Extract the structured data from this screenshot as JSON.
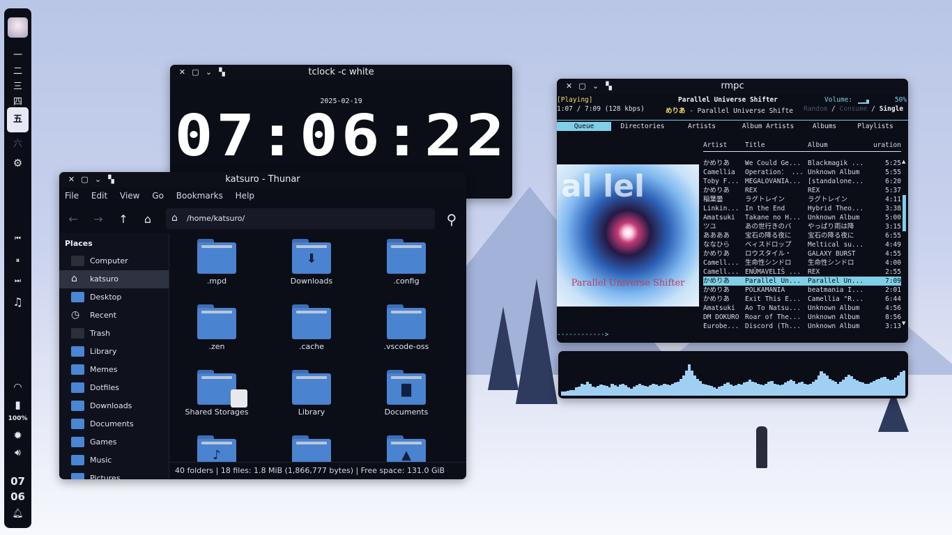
{
  "desktop": {
    "description_colors": {
      "accent": "#7fd0e6",
      "folder": "#4a83cf"
    }
  },
  "bar": {
    "workspaces": [
      "一",
      "二",
      "三",
      "四",
      "五",
      "六"
    ],
    "active_workspace_index": 4,
    "battery_percent": "100%",
    "clock_hour": "07",
    "clock_minute": "06",
    "icons": [
      "settings-icon",
      "previous-icon",
      "pause-icon",
      "next-icon",
      "music-icon",
      "wifi-icon",
      "battery-icon",
      "brightness-icon",
      "volume-icon",
      "bell-icon"
    ]
  },
  "tclock": {
    "window_title": "tclock -c white",
    "date": "2025-02-19",
    "time": "07:06:22"
  },
  "thunar": {
    "window_title": "katsuro - Thunar",
    "menu": [
      "File",
      "Edit",
      "View",
      "Go",
      "Bookmarks",
      "Help"
    ],
    "path": "/home/katsuro/",
    "places_header": "Places",
    "places": [
      {
        "label": "Computer",
        "icon": "computer-icon"
      },
      {
        "label": "katsuro",
        "icon": "home-icon",
        "selected": true
      },
      {
        "label": "Desktop",
        "icon": "folder-icon"
      },
      {
        "label": "Recent",
        "icon": "clock-icon"
      },
      {
        "label": "Trash",
        "icon": "trash-icon"
      },
      {
        "label": "Library",
        "icon": "folder-icon"
      },
      {
        "label": "Memes",
        "icon": "folder-icon"
      },
      {
        "label": "Dotfiles",
        "icon": "folder-icon"
      },
      {
        "label": "Downloads",
        "icon": "folder-icon"
      },
      {
        "label": "Documents",
        "icon": "folder-icon"
      },
      {
        "label": "Games",
        "icon": "folder-icon"
      },
      {
        "label": "Music",
        "icon": "folder-icon"
      },
      {
        "label": "Pictures",
        "icon": "folder-icon"
      }
    ],
    "items": [
      {
        "label": ".mpd",
        "glyph": ""
      },
      {
        "label": "Downloads",
        "glyph": "⬇"
      },
      {
        "label": ".config",
        "glyph": ""
      },
      {
        "label": ".zen",
        "glyph": ""
      },
      {
        "label": ".cache",
        "glyph": ""
      },
      {
        "label": ".vscode-oss",
        "glyph": ""
      },
      {
        "label": "Shared Storages",
        "glyph": ""
      },
      {
        "label": "Library",
        "glyph": ""
      },
      {
        "label": "Documents",
        "glyph": "▇"
      },
      {
        "label": "",
        "glyph": "♪"
      },
      {
        "label": "",
        "glyph": ""
      },
      {
        "label": "",
        "glyph": "▲"
      }
    ],
    "status": "40 folders  |  18 files: 1.8 MiB (1,866,777 bytes)  |  Free space: 131.0 GiB"
  },
  "rmpc": {
    "window_title": "rmpc",
    "state": "[Playing]",
    "song_title": "Parallel Universe Shifter",
    "volume_label": "Volume:",
    "volume_percent": "50%",
    "elapsed": "1:07 / 7:09 (128 kbps)",
    "now_artist": "めりあ",
    "now_line": " - Parallel Universe Shifte",
    "modes": {
      "random": "Random",
      "sep1": " / ",
      "consume": "Consume",
      "sep2": " / ",
      "single": "Single"
    },
    "tabs": [
      "Queue",
      "Directories",
      "Artists",
      "Album Artists",
      "Albums",
      "Playlists"
    ],
    "active_tab": 0,
    "columns": [
      "Artist",
      "Title",
      "Album",
      "uration"
    ],
    "album_art_text": "Parallel Universe Shifter",
    "album_art_big": "al lel",
    "queue": [
      [
        "かめりあ",
        "We Could Ge...",
        "Blackmagik ...",
        "5:25"
      ],
      [
        "Camellia",
        "Operation： ...",
        "Unknown Album",
        "5:55"
      ],
      [
        "Toby F...",
        "MEGALOVANIA...",
        "[standalone...",
        "6:20"
      ],
      [
        "かめりあ",
        "REX",
        "REX",
        "5:37"
      ],
      [
        "稲葉曇",
        "ラグトレイン",
        "ラグトレイン",
        "4:11"
      ],
      [
        "Linkin...",
        "In the End",
        "Hybrid Theo...",
        "3:38"
      ],
      [
        "Amatsuki",
        "Takane no H...",
        "Unknown Album",
        "5:00"
      ],
      [
        "ツユ",
        "あの世行きのバ",
        "やっぱり雨は降",
        "3:15"
      ],
      [
        "ああああ",
        "宝石の降る夜に",
        "宝石の降る夜に",
        "6:55"
      ],
      [
        "ななひら",
        "ベィスドロップ",
        "Meltical su...",
        "4:49"
      ],
      [
        "かめりあ",
        "ロウスタイル・",
        "GALAXY BURST",
        "4:55"
      ],
      [
        "Camell...",
        "生命性シンドロ",
        "生命性シンドロ",
        "4:00"
      ],
      [
        "Camell...",
        "ENŪMAVELIŠ ...",
        "REX",
        "2:55"
      ],
      [
        "かめりあ",
        "Parallel Un...",
        "Parallel Un...",
        "7:09"
      ],
      [
        "かめりあ",
        "POLKAMANIA",
        "beatmania I...",
        "2:01"
      ],
      [
        "かめりあ",
        "Exit This E...",
        "Camellia \"R...",
        "6:44"
      ],
      [
        "Amatsuki",
        "Ao To Natsu...",
        "Unknown Album",
        "4:56"
      ],
      [
        "DM DOKURO",
        "Roar of The...",
        "Unknown Album",
        "8:56"
      ],
      [
        "Eurobe...",
        "Discord (Th...",
        "Unknown Album",
        "3:13"
      ]
    ],
    "selected_row": 13,
    "progress_fraction": 0.156,
    "progress_text": "------------>"
  },
  "visualizer": {
    "levels": [
      0.1,
      0.1,
      0.12,
      0.14,
      0.13,
      0.2,
      0.22,
      0.3,
      0.28,
      0.35,
      0.3,
      0.22,
      0.2,
      0.24,
      0.28,
      0.26,
      0.25,
      0.2,
      0.3,
      0.26,
      0.22,
      0.28,
      0.3,
      0.26,
      0.2,
      0.18,
      0.22,
      0.26,
      0.3,
      0.26,
      0.24,
      0.22,
      0.26,
      0.3,
      0.28,
      0.24,
      0.26,
      0.3,
      0.28,
      0.26,
      0.3,
      0.32,
      0.35,
      0.42,
      0.5,
      0.62,
      0.78,
      0.62,
      0.5,
      0.42,
      0.36,
      0.3,
      0.28,
      0.26,
      0.24,
      0.2,
      0.18,
      0.22,
      0.24,
      0.3,
      0.32,
      0.28,
      0.24,
      0.26,
      0.3,
      0.28,
      0.32,
      0.34,
      0.4,
      0.35,
      0.32,
      0.3,
      0.28,
      0.26,
      0.3,
      0.34,
      0.36,
      0.3,
      0.28,
      0.26,
      0.28,
      0.32,
      0.36,
      0.4,
      0.36,
      0.3,
      0.32,
      0.34,
      0.3,
      0.28,
      0.3,
      0.34,
      0.4,
      0.5,
      0.6,
      0.56,
      0.5,
      0.42,
      0.38,
      0.34,
      0.3,
      0.34,
      0.4,
      0.46,
      0.52,
      0.48,
      0.42,
      0.38,
      0.34,
      0.32,
      0.3,
      0.3,
      0.32,
      0.36,
      0.4,
      0.42,
      0.44,
      0.46,
      0.42,
      0.38,
      0.4,
      0.44,
      0.5,
      0.58,
      0.62
    ]
  }
}
